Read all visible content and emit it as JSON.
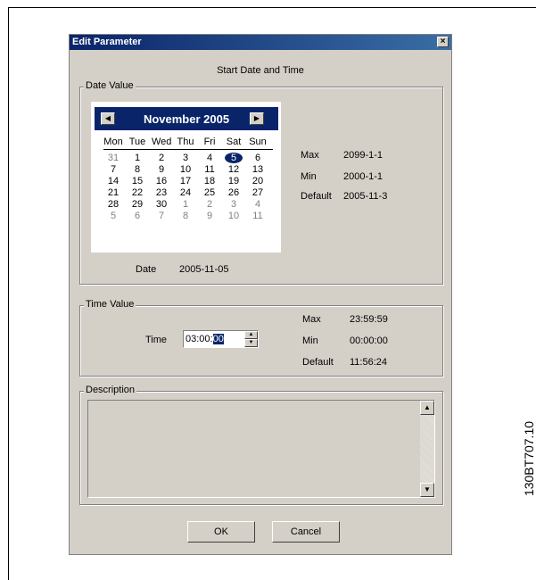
{
  "figure_code": "130BT707.10",
  "window": {
    "title": "Edit Parameter",
    "close_glyph": "×"
  },
  "heading": "Start Date and Time",
  "date_group": {
    "legend": "Date Value",
    "calendar": {
      "month_label": "November 2005",
      "prev_glyph": "◀",
      "next_glyph": "▶",
      "weekdays": [
        "Mon",
        "Tue",
        "Wed",
        "Thu",
        "Fri",
        "Sat",
        "Sun"
      ],
      "weeks": [
        [
          "31",
          "1",
          "2",
          "3",
          "4",
          "5",
          "6"
        ],
        [
          "7",
          "8",
          "9",
          "10",
          "11",
          "12",
          "13"
        ],
        [
          "14",
          "15",
          "16",
          "17",
          "18",
          "19",
          "20"
        ],
        [
          "21",
          "22",
          "23",
          "24",
          "25",
          "26",
          "27"
        ],
        [
          "28",
          "29",
          "30",
          "1",
          "2",
          "3",
          "4"
        ],
        [
          "5",
          "6",
          "7",
          "8",
          "9",
          "10",
          "11"
        ]
      ],
      "selected_day": "5"
    },
    "max_label": "Max",
    "max_value": "2099-1-1",
    "min_label": "Min",
    "min_value": "2000-1-1",
    "default_label": "Default",
    "default_value": "2005-11-3",
    "date_label": "Date",
    "date_value": "2005-11-05"
  },
  "time_group": {
    "legend": "Time Value",
    "time_label": "Time",
    "time_value_prefix": "03:00:",
    "time_value_selected": "00",
    "spin_up_glyph": "▲",
    "spin_down_glyph": "▼",
    "max_label": "Max",
    "max_value": "23:59:59",
    "min_label": "Min",
    "min_value": "00:00:00",
    "default_label": "Default",
    "default_value": "11:56:24"
  },
  "description_group": {
    "legend": "Description",
    "text": "",
    "scroll_up_glyph": "▲",
    "scroll_down_glyph": "▼"
  },
  "buttons": {
    "ok": "OK",
    "cancel": "Cancel"
  }
}
